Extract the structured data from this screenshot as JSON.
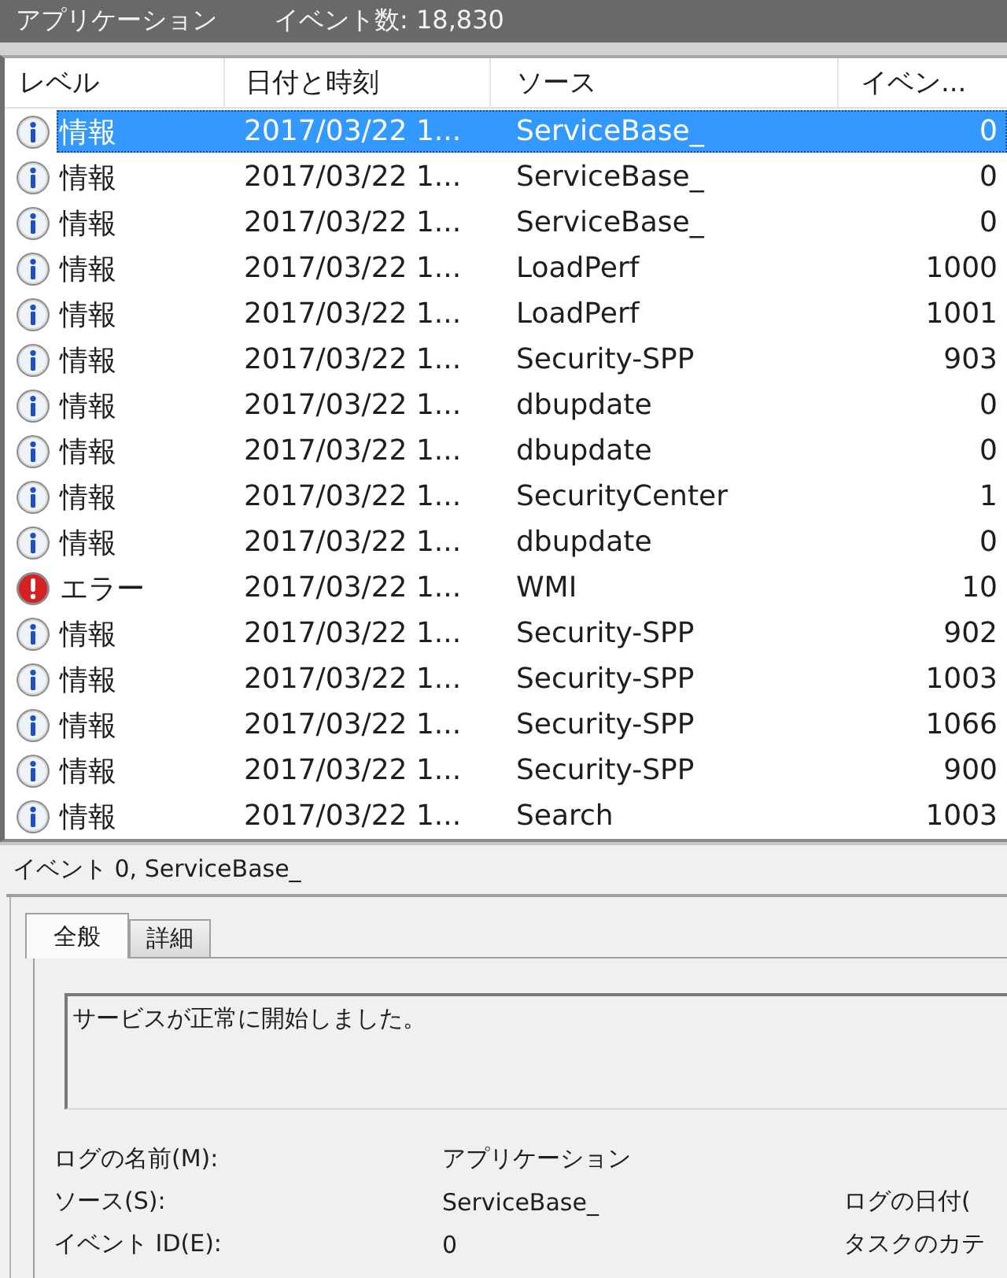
{
  "header": {
    "title": "アプリケーション",
    "event_count": "イベント数: 18,830"
  },
  "table": {
    "columns": [
      "レベル",
      "日付と時刻",
      "ソース",
      "イベン..."
    ],
    "rows": [
      {
        "kind": "info",
        "level_label": "情報",
        "date": "2017/03/22 1...",
        "source": "ServiceBase_",
        "event_id": "0",
        "selected": true
      },
      {
        "kind": "info",
        "level_label": "情報",
        "date": "2017/03/22 1...",
        "source": "ServiceBase_",
        "event_id": "0",
        "selected": false
      },
      {
        "kind": "info",
        "level_label": "情報",
        "date": "2017/03/22 1...",
        "source": "ServiceBase_",
        "event_id": "0",
        "selected": false
      },
      {
        "kind": "info",
        "level_label": "情報",
        "date": "2017/03/22 1...",
        "source": "LoadPerf",
        "event_id": "1000",
        "selected": false
      },
      {
        "kind": "info",
        "level_label": "情報",
        "date": "2017/03/22 1...",
        "source": "LoadPerf",
        "event_id": "1001",
        "selected": false
      },
      {
        "kind": "info",
        "level_label": "情報",
        "date": "2017/03/22 1...",
        "source": "Security-SPP",
        "event_id": "903",
        "selected": false
      },
      {
        "kind": "info",
        "level_label": "情報",
        "date": "2017/03/22 1...",
        "source": "dbupdate",
        "event_id": "0",
        "selected": false
      },
      {
        "kind": "info",
        "level_label": "情報",
        "date": "2017/03/22 1...",
        "source": "dbupdate",
        "event_id": "0",
        "selected": false
      },
      {
        "kind": "info",
        "level_label": "情報",
        "date": "2017/03/22 1...",
        "source": "SecurityCenter",
        "event_id": "1",
        "selected": false
      },
      {
        "kind": "info",
        "level_label": "情報",
        "date": "2017/03/22 1...",
        "source": "dbupdate",
        "event_id": "0",
        "selected": false
      },
      {
        "kind": "error",
        "level_label": "エラー",
        "date": "2017/03/22 1...",
        "source": "WMI",
        "event_id": "10",
        "selected": false
      },
      {
        "kind": "info",
        "level_label": "情報",
        "date": "2017/03/22 1...",
        "source": "Security-SPP",
        "event_id": "902",
        "selected": false
      },
      {
        "kind": "info",
        "level_label": "情報",
        "date": "2017/03/22 1...",
        "source": "Security-SPP",
        "event_id": "1003",
        "selected": false
      },
      {
        "kind": "info",
        "level_label": "情報",
        "date": "2017/03/22 1...",
        "source": "Security-SPP",
        "event_id": "1066",
        "selected": false
      },
      {
        "kind": "info",
        "level_label": "情報",
        "date": "2017/03/22 1...",
        "source": "Security-SPP",
        "event_id": "900",
        "selected": false
      },
      {
        "kind": "info",
        "level_label": "情報",
        "date": "2017/03/22 1...",
        "source": "Search",
        "event_id": "1003",
        "selected": false
      }
    ]
  },
  "details": {
    "title": "イベント 0, ServiceBase_",
    "tabs": [
      {
        "label": "全般",
        "selected": true
      },
      {
        "label": "詳細",
        "selected": false
      }
    ],
    "description": "サービスが正常に開始しました。",
    "fields": [
      {
        "label": "ログの名前(M):",
        "value": "アプリケーション"
      },
      {
        "label": "ソース(S):",
        "value": "ServiceBase_",
        "side_label": "ログの日付("
      },
      {
        "label": "イベント ID(E):",
        "value": "0",
        "side_label": "タスクのカテ"
      }
    ]
  }
}
